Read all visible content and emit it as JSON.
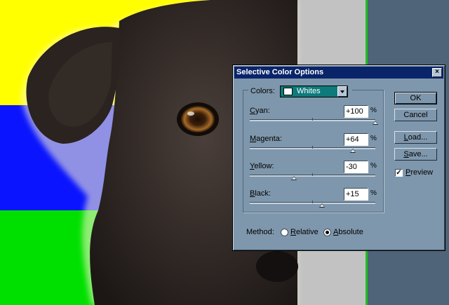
{
  "dialog": {
    "title": "Selective Color Options",
    "close_label": "×"
  },
  "colors": {
    "label": "Colors:",
    "selected": "Whites",
    "swatch_color": "#ffffff"
  },
  "sliders": [
    {
      "name": "Cyan",
      "value": "+100",
      "unit": "%",
      "percent": 100
    },
    {
      "name": "Magenta",
      "value": "+64",
      "unit": "%",
      "percent": 64
    },
    {
      "name": "Yellow",
      "value": "-30",
      "unit": "%",
      "percent": -30
    },
    {
      "name": "Black",
      "value": "+15",
      "unit": "%",
      "percent": 15
    }
  ],
  "buttons": {
    "ok": "OK",
    "cancel": "Cancel",
    "load": "Load...",
    "save": "Save..."
  },
  "preview": {
    "label": "Preview",
    "checked": true
  },
  "method": {
    "label": "Method:",
    "options": [
      {
        "label": "Relative",
        "selected": false
      },
      {
        "label": "Absolute",
        "selected": true
      }
    ]
  },
  "colors_theme": {
    "dialog_bg": "#7f97ac",
    "titlebar": "#0a246a",
    "select_bg": "#0e7a7a"
  }
}
